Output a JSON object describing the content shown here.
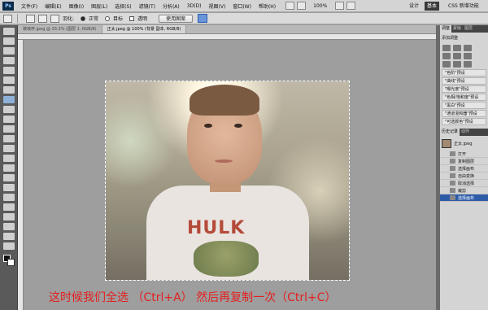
{
  "app": {
    "logo": "Ps"
  },
  "menu": [
    "文件(F)",
    "编辑(E)",
    "图像(I)",
    "图层(L)",
    "选择(S)",
    "滤镜(T)",
    "分析(A)",
    "3D(D)",
    "视图(V)",
    "窗口(W)",
    "帮助(H)"
  ],
  "menubar": {
    "zoom": "100%",
    "workspaces": [
      "设计",
      "基本",
      "CSS 新增功能"
    ],
    "active_workspace": "基本"
  },
  "options": {
    "feather_label": "羽化:",
    "mode_normal": "正常",
    "mode_target": "目标",
    "transparent_label": "透明",
    "use_pattern_button": "使用图案"
  },
  "documents": [
    {
      "title": "玻璃杯.jpeg @ 33.3% (图层 1, RGB/8)",
      "active": false
    },
    {
      "title": "正太.jpeg @ 100% (背景 副本, RGB/8)",
      "active": true
    }
  ],
  "photo": {
    "shirt_text": "HULK"
  },
  "caption": "这时候我们全选 （Ctrl+A） 然后再复制一次（Ctrl+C）",
  "panels": {
    "top_tabs": [
      "调整",
      "蒙版",
      "图层"
    ],
    "adjust_title": "添加调整",
    "presets": [
      "\"色阶\"预设",
      "\"曲线\"预设",
      "\"曝光度\"预设",
      "\"色相/饱和度\"预设",
      "\"黑白\"预设",
      "\"通道混和器\"预设",
      "\"可选颜色\"预设"
    ],
    "history_tabs": [
      "历史记录",
      "动作"
    ],
    "snapshot": "正太.jpeg",
    "history_items": [
      "打开",
      "复制图层",
      "选择画布",
      "自由变换",
      "取消选择",
      "裁剪",
      "选择画布"
    ],
    "active_history_index": 6
  },
  "colors": {
    "caption": "#e41f1f",
    "active_history": "#2d5ba8"
  }
}
